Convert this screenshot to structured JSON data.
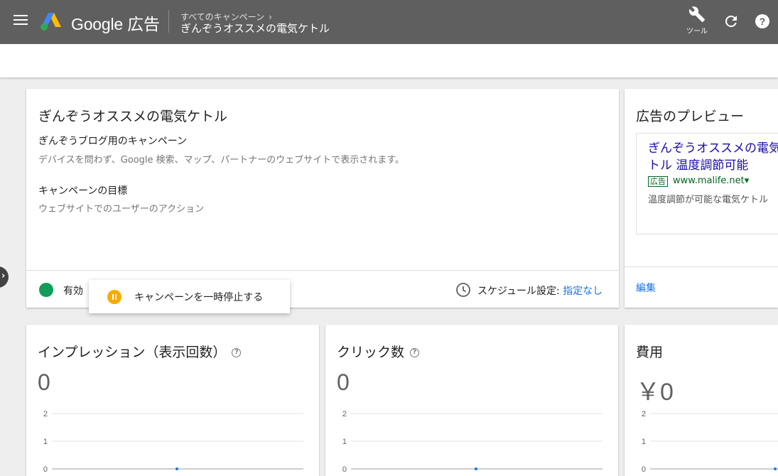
{
  "header": {
    "logo_text": "Google 広告",
    "breadcrumb": "すべてのキャンペーン",
    "breadcrumb_chevron": "›",
    "campaign_name": "ぎんぞうオススメの電気ケトル",
    "tools_label": "ツール"
  },
  "summary": {
    "title": "ぎんぞうオススメの電気ケトル",
    "campaign_type_heading": "ぎんぞうブログ用のキャンペーン",
    "campaign_type_desc": "デバイスを問わず、Google 検索、マップ、パートナーのウェブサイトで表示されます。",
    "goal_heading": "キャンペーンの目標",
    "goal_desc": "ウェブサイトでのユーザーのアクション",
    "status_label": "有効",
    "status_color": "#0f9d58",
    "schedule_label": "スケジュール設定: ",
    "schedule_value": "指定なし"
  },
  "pause_popup": {
    "label": "キャンペーンを一時停止する",
    "icon": "pause-icon",
    "icon_color": "#f9ab00"
  },
  "preview": {
    "title": "広告のプレビュー",
    "headline": "ぎんぞうオススメの電気ケトル 温度調節可能",
    "badge": "広告",
    "url": "www.malife.net▾",
    "description": "温度調節が可能な電気ケトル",
    "edit_label": "編集"
  },
  "metrics": [
    {
      "title": "インプレッション（表示回数）",
      "value": "0",
      "has_help": true
    },
    {
      "title": "クリック数",
      "value": "0",
      "has_help": true
    },
    {
      "title": "費用",
      "value": "￥0",
      "has_help": false
    }
  ],
  "chart_data": [
    {
      "type": "line",
      "yticks": [
        "2",
        "1",
        "0"
      ],
      "ylim": [
        0,
        2
      ],
      "series": [
        {
          "values": [
            0
          ]
        }
      ]
    },
    {
      "type": "line",
      "yticks": [
        "2",
        "1",
        "0"
      ],
      "ylim": [
        0,
        2
      ],
      "series": [
        {
          "values": [
            0
          ]
        }
      ]
    },
    {
      "type": "line",
      "yticks": [
        "2",
        "1",
        "0"
      ],
      "ylim": [
        0,
        2
      ],
      "series": [
        {
          "values": [
            0
          ]
        }
      ]
    }
  ],
  "colors": {
    "header_bg": "#5f5f5f",
    "link": "#1a73e8",
    "ad_headline": "#1a0dab",
    "ad_green": "#006621",
    "chart_line": "#1a73e8"
  }
}
